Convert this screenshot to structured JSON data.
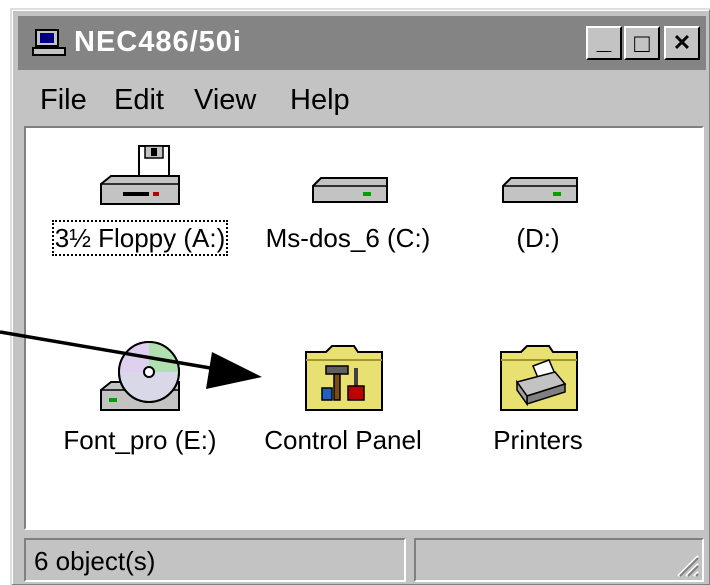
{
  "window": {
    "title": "NEC486/50i",
    "buttons": {
      "minimize": "_",
      "maximize": "□",
      "close": "✕"
    }
  },
  "menu": [
    {
      "label": "File"
    },
    {
      "label": "Edit"
    },
    {
      "label": "View"
    },
    {
      "label": "Help"
    }
  ],
  "icons": [
    {
      "label": "3½ Floppy (A:)",
      "icon": "floppy-drive-icon"
    },
    {
      "label": "Ms-dos_6 (C:)",
      "icon": "hard-drive-icon"
    },
    {
      "label": "(D:)",
      "icon": "hard-drive-icon"
    },
    {
      "label": "Font_pro (E:)",
      "icon": "cd-drive-icon"
    },
    {
      "label": "Control Panel",
      "icon": "control-panel-folder-icon"
    },
    {
      "label": "Printers",
      "icon": "printers-folder-icon"
    }
  ],
  "status": {
    "text": "6 object(s)"
  },
  "colors": {
    "title_bg": "#848484",
    "face": "#c3c3c3",
    "folder": "#e8e070"
  }
}
